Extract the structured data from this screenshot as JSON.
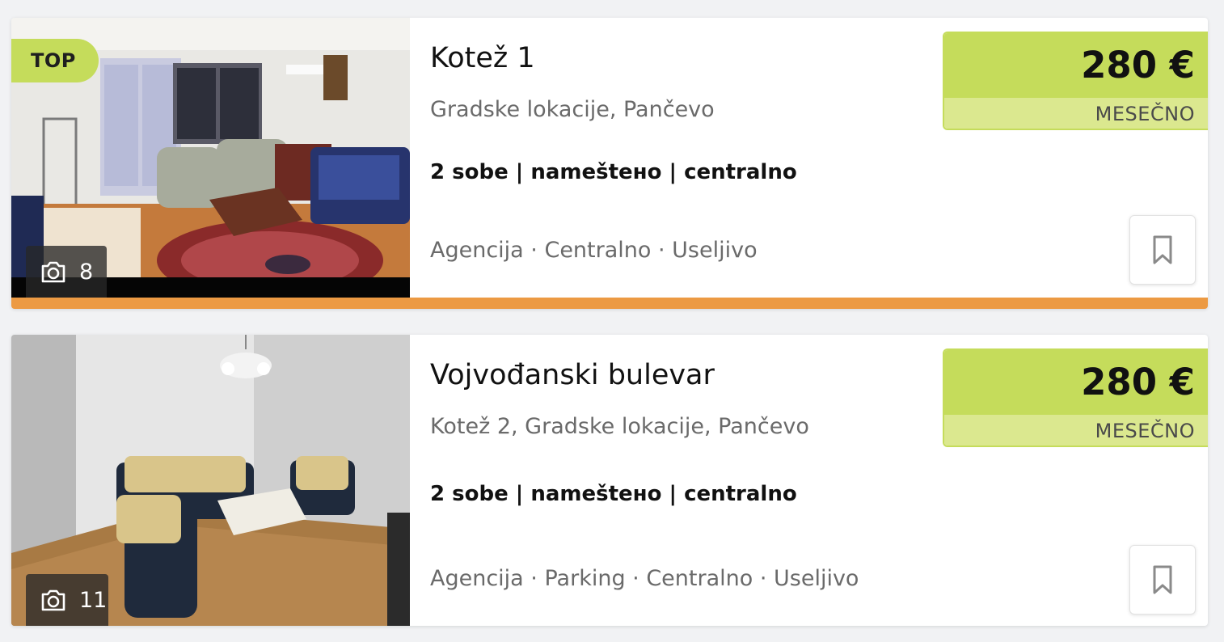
{
  "listings": [
    {
      "badge": "TOP",
      "photo_count": "8",
      "title": "Kotež 1",
      "location": "Gradske lokacije, Pančevo",
      "specs": "2 sobe | nameštено | centralno",
      "tags": "Agencija · Centralno · Useljivo",
      "price": "280 €",
      "period": "MESEČNO"
    },
    {
      "photo_count": "11",
      "title": "Vojvođanski bulevar",
      "location": "Kotež 2, Gradske lokacije, Pančevo",
      "specs": "2 sobe | nameštено | centralno",
      "tags": "Agencija · Parking · Centralno · Useljivo",
      "price": "280 €",
      "period": "MESEČNO"
    }
  ],
  "icons": {
    "photo_count": "camera-icon",
    "save": "bookmark-icon"
  },
  "colors": {
    "price_accent": "#c5dc5b",
    "price_period_bg": "#dbe88f",
    "top_listing_bar": "#ec9a43"
  }
}
